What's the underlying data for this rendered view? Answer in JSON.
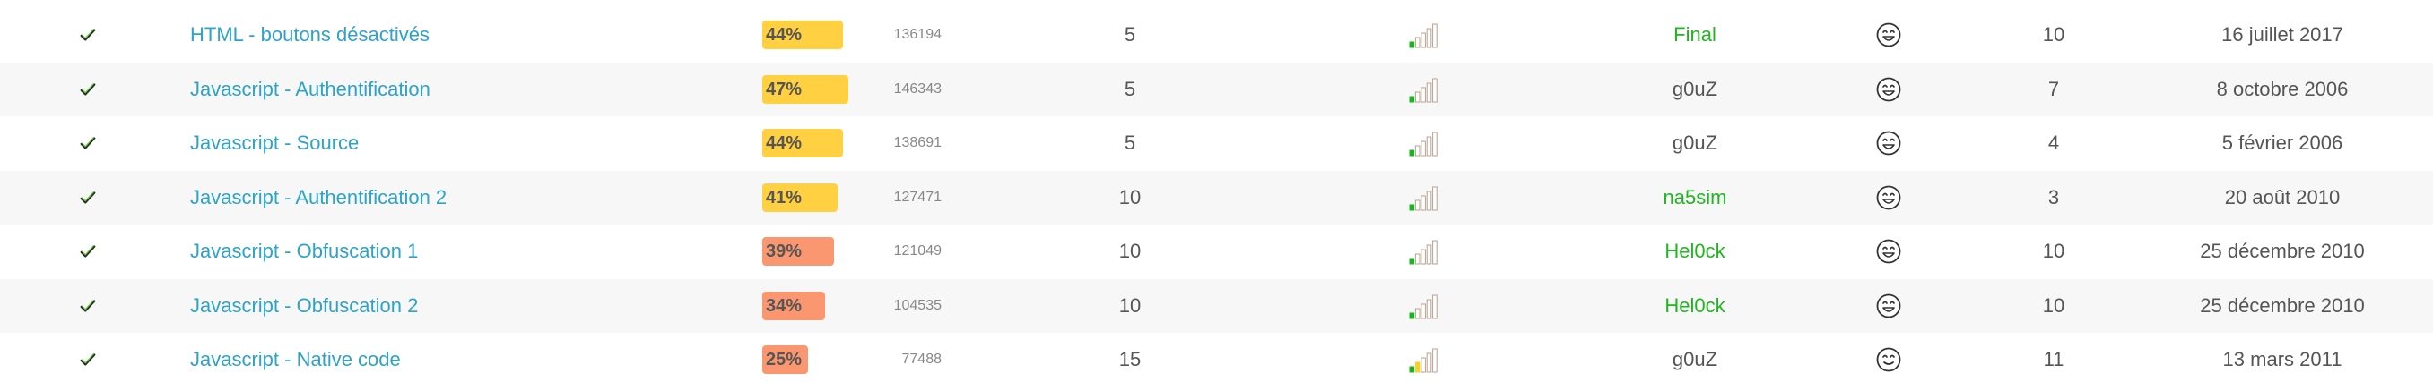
{
  "colors": {
    "link": "#2ea3c9",
    "text": "#555555",
    "author_green": "#22b522",
    "pct_high": "#ffd042",
    "pct_low": "#fb9770",
    "row_alt": "#f7f7f7"
  },
  "icons": {
    "validated": "check-icon",
    "difficulty": "difficulty-bars-icon",
    "rating": "smiley-icon"
  },
  "rows": [
    {
      "title": "HTML - boutons désactivés",
      "pct": "44%",
      "pct_value": 44,
      "pct_color": "yellow",
      "score": "136194",
      "points": "5",
      "difficulty_level": 1,
      "author": "Final",
      "author_highlight": true,
      "rating_face": "smile",
      "votes": "10",
      "date": "16 juillet 2017"
    },
    {
      "title": "Javascript - Authentification",
      "pct": "47%",
      "pct_value": 47,
      "pct_color": "yellow",
      "score": "146343",
      "points": "5",
      "difficulty_level": 1,
      "author": "g0uZ",
      "author_highlight": false,
      "rating_face": "smile",
      "votes": "7",
      "date": "8 octobre 2006"
    },
    {
      "title": "Javascript - Source",
      "pct": "44%",
      "pct_value": 44,
      "pct_color": "yellow",
      "score": "138691",
      "points": "5",
      "difficulty_level": 1,
      "author": "g0uZ",
      "author_highlight": false,
      "rating_face": "smile",
      "votes": "4",
      "date": "5 février 2006"
    },
    {
      "title": "Javascript - Authentification 2",
      "pct": "41%",
      "pct_value": 41,
      "pct_color": "yellow",
      "score": "127471",
      "points": "10",
      "difficulty_level": 1,
      "author": "na5sim",
      "author_highlight": true,
      "rating_face": "smile",
      "votes": "3",
      "date": "20 août 2010"
    },
    {
      "title": "Javascript - Obfuscation 1",
      "pct": "39%",
      "pct_value": 39,
      "pct_color": "orange",
      "score": "121049",
      "points": "10",
      "difficulty_level": 1,
      "author": "Hel0ck",
      "author_highlight": true,
      "rating_face": "smile",
      "votes": "10",
      "date": "25 décembre 2010"
    },
    {
      "title": "Javascript - Obfuscation 2",
      "pct": "34%",
      "pct_value": 34,
      "pct_color": "orange",
      "score": "104535",
      "points": "10",
      "difficulty_level": 1,
      "author": "Hel0ck",
      "author_highlight": true,
      "rating_face": "smile",
      "votes": "10",
      "date": "25 décembre 2010"
    },
    {
      "title": "Javascript - Native code",
      "pct": "25%",
      "pct_value": 25,
      "pct_color": "orange",
      "score": "77488",
      "points": "15",
      "difficulty_level": 2,
      "author": "g0uZ",
      "author_highlight": false,
      "rating_face": "content",
      "votes": "11",
      "date": "13 mars 2011"
    }
  ]
}
